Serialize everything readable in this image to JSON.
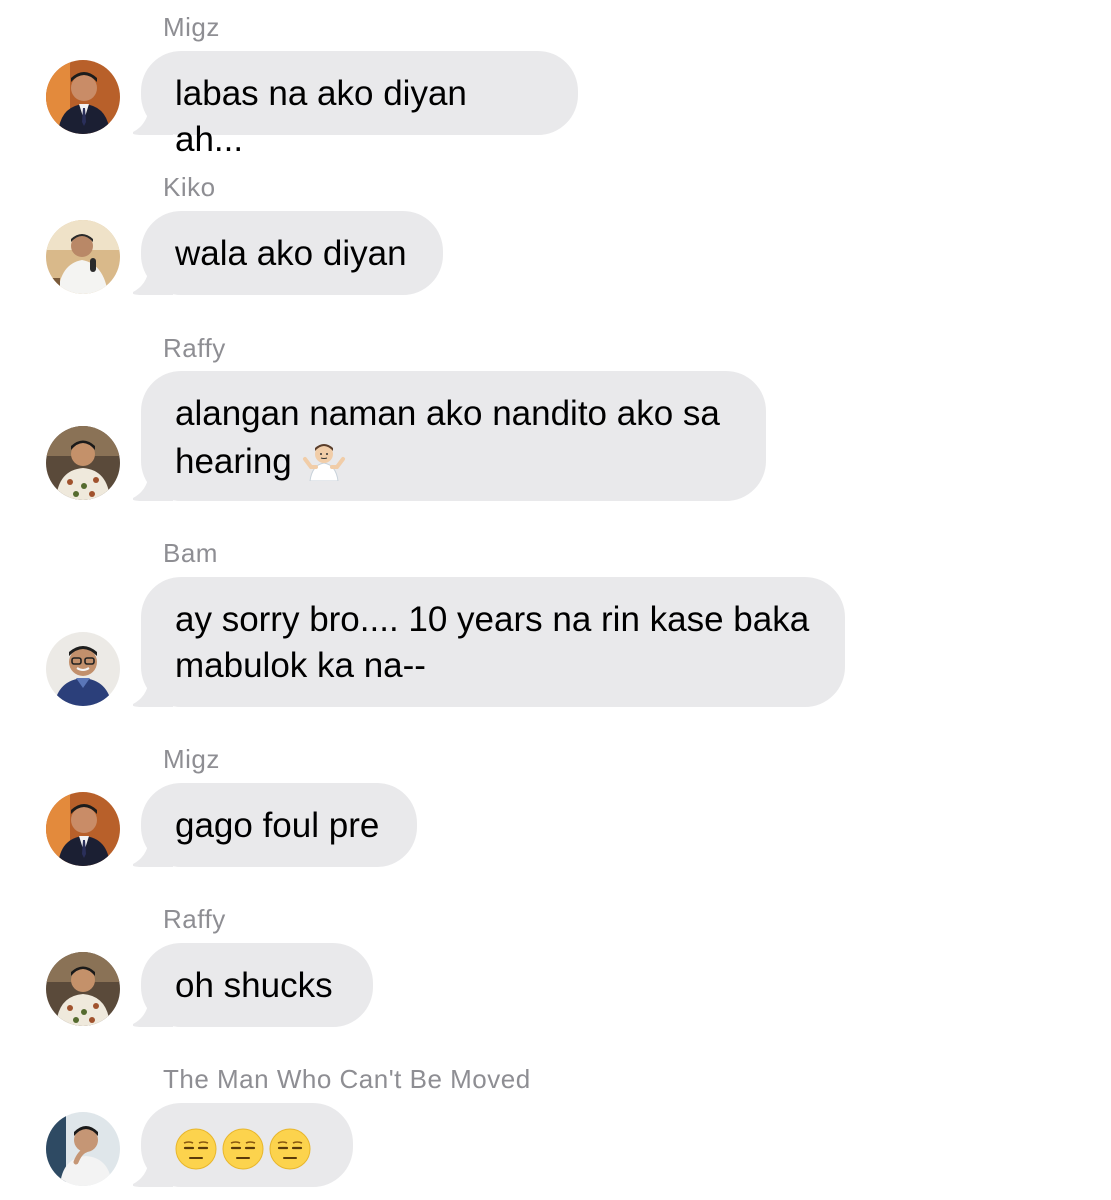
{
  "messages": [
    {
      "sender": "Migz",
      "text": "labas na ako diyan ah...",
      "avatar": "avatar-migz"
    },
    {
      "sender": "Kiko",
      "text": "wala ako diyan",
      "avatar": "avatar-kiko"
    },
    {
      "sender": "Raffy",
      "text_line1": "alangan naman ako nandito ako sa",
      "text_line2": "hearing",
      "emoji": "shrug-emoji",
      "avatar": "avatar-raffy"
    },
    {
      "sender": "Bam",
      "text_line1": "ay sorry bro.... 10 years na rin kase baka",
      "text_line2": "mabulok ka na--",
      "avatar": "avatar-bam"
    },
    {
      "sender": "Migz",
      "text": "gago foul pre",
      "avatar": "avatar-migz"
    },
    {
      "sender": "Raffy",
      "text": "oh shucks",
      "avatar": "avatar-raffy"
    },
    {
      "sender": "The Man Who Can't Be Moved",
      "emoji": "unamused-face-emoji",
      "emoji_count": 3,
      "avatar": "avatar-man"
    }
  ],
  "colors": {
    "bubble": "#e9e9eb",
    "sender_label": "#8e8e93",
    "text": "#000000"
  }
}
